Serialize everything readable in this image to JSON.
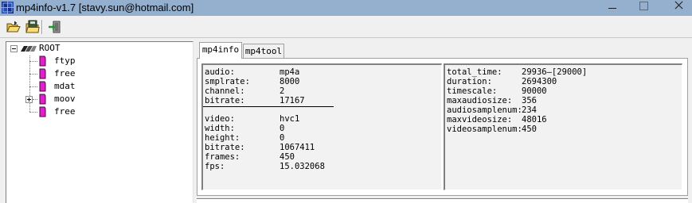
{
  "window": {
    "title": "mp4info-v1.7 [stavy.sun@hotmail.com]"
  },
  "toolbar": {
    "tools": [
      "open-folder-icon",
      "save-folder-icon",
      "exit-icon"
    ]
  },
  "tree": {
    "root": "ROOT",
    "children": [
      "ftyp",
      "free",
      "mdat",
      "moov",
      "free"
    ],
    "collapsed_with_children": [
      "moov"
    ]
  },
  "tabs": [
    "mp4info",
    "mp4tool"
  ],
  "active_tab": "mp4info",
  "info_left": {
    "audio": [
      {
        "key": "audio:",
        "value": "mp4a"
      },
      {
        "key": "smplrate:",
        "value": "8000"
      },
      {
        "key": "channel:",
        "value": "2"
      },
      {
        "key": "bitrate:",
        "value": "17167"
      }
    ],
    "video": [
      {
        "key": "video:",
        "value": "hvc1"
      },
      {
        "key": "width:",
        "value": "0"
      },
      {
        "key": "height:",
        "value": "0"
      },
      {
        "key": "bitrate:",
        "value": "1067411"
      },
      {
        "key": "frames:",
        "value": "450"
      },
      {
        "key": "fps:",
        "value": "15.032068"
      }
    ]
  },
  "info_right": [
    {
      "key": "total_time:",
      "value": "29936—[29000]"
    },
    {
      "key": "duration:",
      "value": "2694300"
    },
    {
      "key": "timescale:",
      "value": "90000"
    },
    {
      "key": "maxaudiosize:",
      "value": "356"
    },
    {
      "key": "audiosamplenum:",
      "value": "234"
    },
    {
      "key": "maxvideosize:",
      "value": "48016"
    },
    {
      "key": "videosamplenum:",
      "value": "450"
    }
  ],
  "colors": {
    "titlebar": "#95b0cf",
    "tree_icon": "#e020c8",
    "panel_bg": "#f2f2f2"
  }
}
